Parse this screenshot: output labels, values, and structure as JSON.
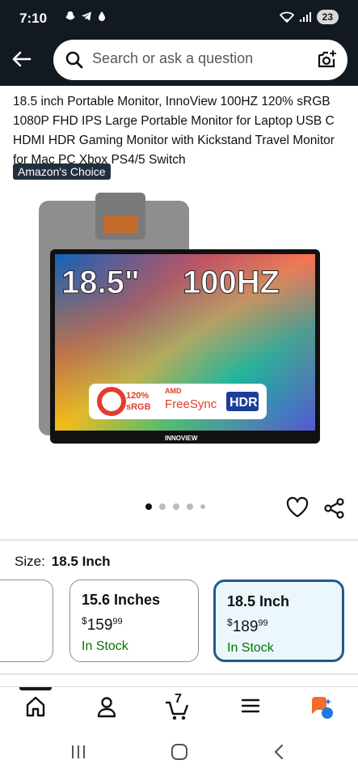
{
  "status_bar": {
    "time": "7:10",
    "battery": "23"
  },
  "search": {
    "placeholder": "Search or ask a question"
  },
  "product": {
    "title": "18.5 inch Portable Monitor, InnoView 100HZ 120% sRGB 1080P FHD IPS Large Portable Monitor for Laptop USB C HDMI HDR Gaming Monitor with Kickstand Travel Monitor for Mac PC Xbox PS4/5 Switch",
    "badge": "Amazon's Choice",
    "image_text": {
      "size": "18.5\"",
      "refresh": "100HZ",
      "srgb_pct": "120%",
      "srgb": "sRGB",
      "amd": "AMD",
      "freesync": "FreeSync",
      "hdr": "HDR",
      "brand": "INNOVIEW"
    }
  },
  "size_selector": {
    "label": "Size:",
    "selected": "18.5 Inch",
    "options": [
      {
        "name": "15.6 Inches",
        "currency": "$",
        "dollars": "159",
        "cents": "99",
        "stock": "In Stock"
      },
      {
        "name": "18.5 Inch",
        "currency": "$",
        "dollars": "189",
        "cents": "99",
        "stock": "In Stock"
      }
    ]
  },
  "bottom_nav": {
    "cart_count": "7"
  },
  "colors": {
    "header_bg": "#131921",
    "in_stock": "#007600",
    "selected_border": "#1f5c8a",
    "selected_bg": "#ebf6fd"
  }
}
